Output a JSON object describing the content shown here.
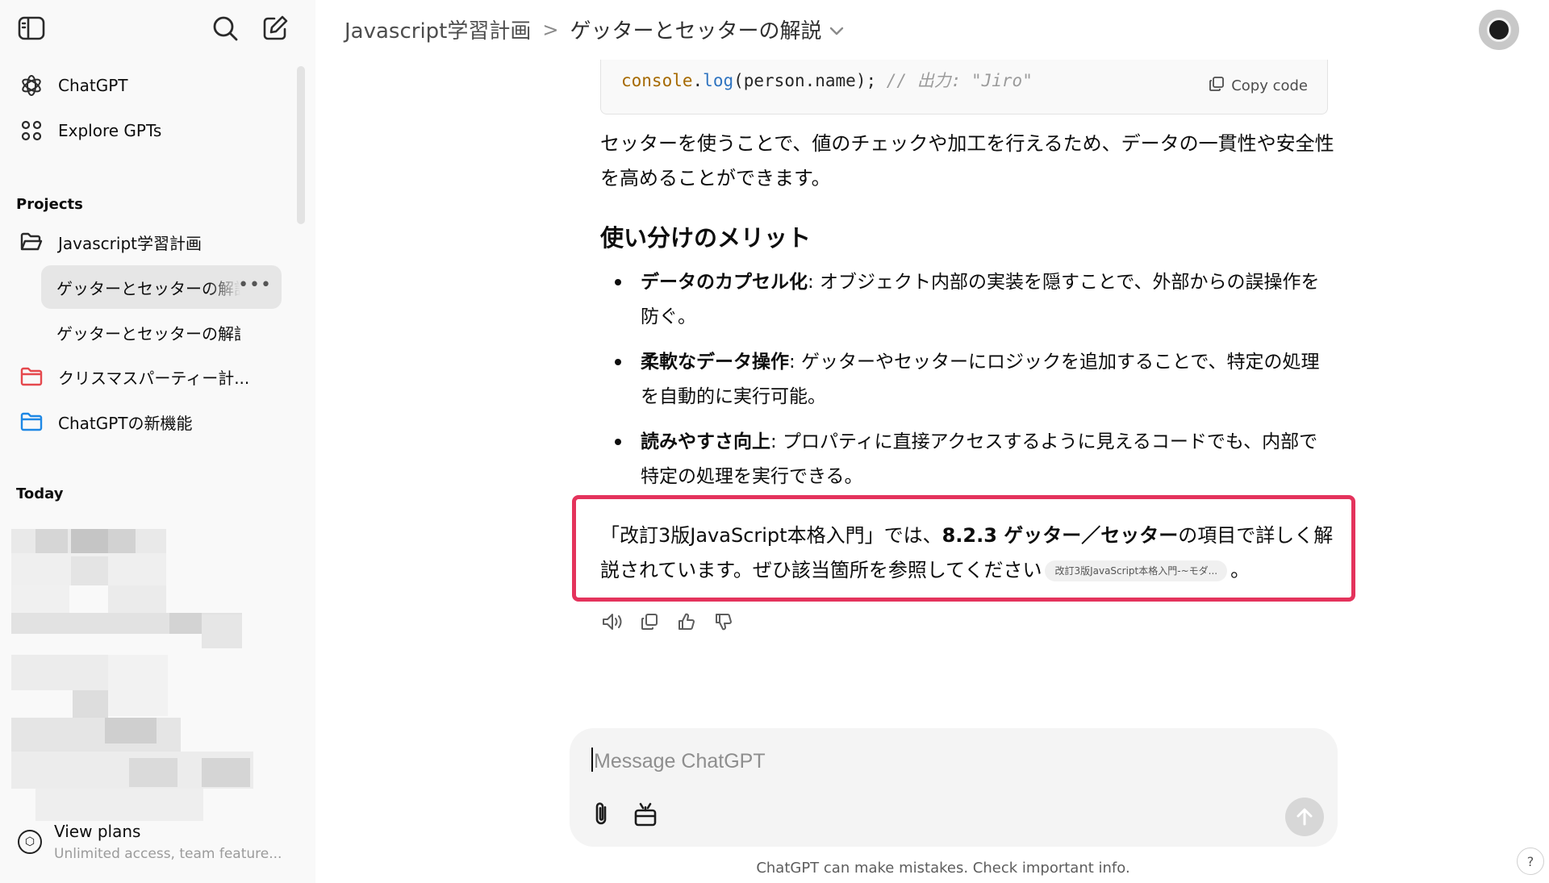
{
  "sidebar": {
    "top_nav": [
      {
        "label": "ChatGPT",
        "icon": "openai-logo-icon"
      },
      {
        "label": "Explore GPTs",
        "icon": "grid-icon"
      }
    ],
    "projects_heading": "Projects",
    "projects": [
      {
        "label": "Javascript学習計画",
        "icon": "folder-open-icon",
        "color": "#0d0d0d"
      },
      {
        "label": "ゲッターとセッターの解説",
        "type": "chat",
        "active": true
      },
      {
        "label": "ゲッターとセッターの解説",
        "type": "chat",
        "active": false
      },
      {
        "label": "クリスマスパーティー計...",
        "icon": "folder-icon",
        "color": "#e5484d"
      },
      {
        "label": "ChatGPTの新機能",
        "icon": "folder-icon",
        "color": "#1e88e5"
      }
    ],
    "today_heading": "Today",
    "view_plans": {
      "title": "View plans",
      "subtitle": "Unlimited access, team feature..."
    }
  },
  "header": {
    "project": "Javascript学習計画",
    "separator": ">",
    "chat_title": "ゲッターとセッターの解説"
  },
  "conversation": {
    "code": {
      "obj": "console",
      "dot": ".",
      "fn": "log",
      "args": "(person.name); ",
      "comment": "// 出力: \"Jiro\"",
      "copy_label": "Copy code"
    },
    "setter_paragraph": "セッターを使うことで、値のチェックや加工を行えるため、データの一貫性や安全性を高めることができます。",
    "heading": "使い分けのメリット",
    "bullets": [
      {
        "bold": "データのカプセル化",
        "text": ": オブジェクト内部の実装を隠すことで、外部からの誤操作を防ぐ。"
      },
      {
        "bold": "柔軟なデータ操作",
        "text": ": ゲッターやセッターにロジックを追加することで、特定の処理を自動的に実行可能。"
      },
      {
        "bold": "読みやすさ向上",
        "text": ": プロパティに直接アクセスするように見えるコードでも、内部で特定の処理を実行できる。"
      }
    ],
    "reference": {
      "prefix": "「改訂3版JavaScript本格入門」では、",
      "bold": "8.2.3 ゲッター／セッター",
      "suffix": "の項目で詳しく解説されています。ぜひ該当箇所を参照してください",
      "citation": "改訂3版JavaScript本格入門-~モダ...",
      "end": "。",
      "highlight_color": "#e4335c"
    }
  },
  "composer": {
    "placeholder": "Message ChatGPT",
    "value": ""
  },
  "footer": {
    "disclaimer": "ChatGPT can make mistakes. Check important info.",
    "help": "?"
  }
}
